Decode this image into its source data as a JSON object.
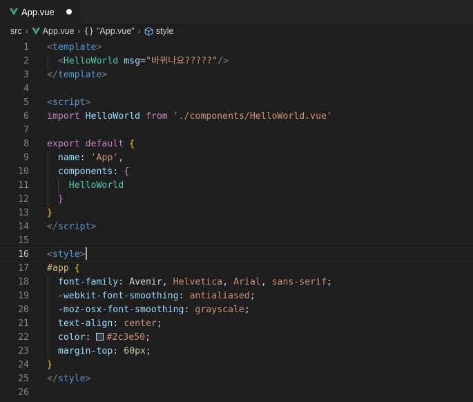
{
  "tab": {
    "label": "App.vue",
    "icon": "vue-logo-icon",
    "dirty": true
  },
  "breadcrumb": {
    "items": [
      "src",
      "App.vue",
      "\"App.vue\"",
      "style"
    ],
    "icons": [
      "",
      "vue-logo-icon",
      "braces-icon",
      "cube-icon"
    ],
    "braces_glyph": "{}"
  },
  "editor": {
    "current_line": 16,
    "lines": [
      {
        "n": "1",
        "tokens": [
          [
            "t-tag",
            "<"
          ],
          [
            "t-name",
            "template"
          ],
          [
            "t-tag",
            ">"
          ]
        ]
      },
      {
        "n": "2",
        "tokens": [
          [
            "t-plain",
            "  "
          ],
          [
            "t-tag",
            "<"
          ],
          [
            "t-comp",
            "HelloWorld"
          ],
          [
            "t-plain",
            " "
          ],
          [
            "t-attr",
            "msg"
          ],
          [
            "t-punc",
            "="
          ],
          [
            "t-str",
            "\"바뀌나요?????\""
          ],
          [
            "t-tag",
            "/>"
          ]
        ]
      },
      {
        "n": "3",
        "tokens": [
          [
            "t-tag",
            "</"
          ],
          [
            "t-name",
            "template"
          ],
          [
            "t-tag",
            ">"
          ]
        ]
      },
      {
        "n": "4",
        "tokens": []
      },
      {
        "n": "5",
        "tokens": [
          [
            "t-tag",
            "<"
          ],
          [
            "t-name",
            "script"
          ],
          [
            "t-tag",
            ">"
          ]
        ]
      },
      {
        "n": "6",
        "tokens": [
          [
            "t-kw",
            "import"
          ],
          [
            "t-plain",
            " "
          ],
          [
            "t-attr",
            "HelloWorld"
          ],
          [
            "t-plain",
            " "
          ],
          [
            "t-kw",
            "from"
          ],
          [
            "t-plain",
            " "
          ],
          [
            "t-str",
            "'./components/HelloWorld.vue'"
          ]
        ]
      },
      {
        "n": "7",
        "tokens": []
      },
      {
        "n": "8",
        "tokens": [
          [
            "t-kw",
            "export"
          ],
          [
            "t-plain",
            " "
          ],
          [
            "t-kw",
            "default"
          ],
          [
            "t-plain",
            " "
          ],
          [
            "t-brace1",
            "{"
          ]
        ]
      },
      {
        "n": "9",
        "tokens": [
          [
            "t-plain",
            "  "
          ],
          [
            "t-attr",
            "name"
          ],
          [
            "t-punc",
            ": "
          ],
          [
            "t-str",
            "'App'"
          ],
          [
            "t-punc",
            ","
          ]
        ]
      },
      {
        "n": "10",
        "tokens": [
          [
            "t-plain",
            "  "
          ],
          [
            "t-attr",
            "components"
          ],
          [
            "t-punc",
            ": "
          ],
          [
            "t-brace2",
            "{"
          ]
        ]
      },
      {
        "n": "11",
        "tokens": [
          [
            "t-plain",
            "    "
          ],
          [
            "t-comp",
            "HelloWorld"
          ]
        ]
      },
      {
        "n": "12",
        "tokens": [
          [
            "t-plain",
            "  "
          ],
          [
            "t-brace2",
            "}"
          ]
        ]
      },
      {
        "n": "13",
        "tokens": [
          [
            "t-brace1",
            "}"
          ]
        ]
      },
      {
        "n": "14",
        "tokens": [
          [
            "t-tag",
            "</"
          ],
          [
            "t-name",
            "script"
          ],
          [
            "t-tag",
            ">"
          ]
        ]
      },
      {
        "n": "15",
        "tokens": []
      },
      {
        "n": "16",
        "tokens": [
          [
            "t-tag",
            "<"
          ],
          [
            "t-name",
            "style"
          ],
          [
            "t-tag",
            ">"
          ]
        ],
        "cursor": true
      },
      {
        "n": "17",
        "tokens": [
          [
            "t-sel",
            "#app"
          ],
          [
            "t-plain",
            " "
          ],
          [
            "t-brace1",
            "{"
          ]
        ]
      },
      {
        "n": "18",
        "tokens": [
          [
            "t-plain",
            "  "
          ],
          [
            "t-prop",
            "font-family"
          ],
          [
            "t-punc",
            ": "
          ],
          [
            "t-plain",
            "Avenir"
          ],
          [
            "t-punc",
            ", "
          ],
          [
            "t-val",
            "Helvetica"
          ],
          [
            "t-punc",
            ", "
          ],
          [
            "t-val",
            "Arial"
          ],
          [
            "t-punc",
            ", "
          ],
          [
            "t-val",
            "sans-serif"
          ],
          [
            "t-punc",
            ";"
          ]
        ]
      },
      {
        "n": "19",
        "tokens": [
          [
            "t-plain",
            "  "
          ],
          [
            "t-prop",
            "-webkit-font-smoothing"
          ],
          [
            "t-punc",
            ": "
          ],
          [
            "t-val",
            "antialiased"
          ],
          [
            "t-punc",
            ";"
          ]
        ]
      },
      {
        "n": "20",
        "tokens": [
          [
            "t-plain",
            "  "
          ],
          [
            "t-prop",
            "-moz-osx-font-smoothing"
          ],
          [
            "t-punc",
            ": "
          ],
          [
            "t-val",
            "grayscale"
          ],
          [
            "t-punc",
            ";"
          ]
        ]
      },
      {
        "n": "21",
        "tokens": [
          [
            "t-plain",
            "  "
          ],
          [
            "t-prop",
            "text-align"
          ],
          [
            "t-punc",
            ": "
          ],
          [
            "t-val",
            "center"
          ],
          [
            "t-punc",
            ";"
          ]
        ]
      },
      {
        "n": "22",
        "tokens": [
          [
            "t-plain",
            "  "
          ],
          [
            "t-prop",
            "color"
          ],
          [
            "t-punc",
            ": "
          ],
          [
            "swatch",
            ""
          ],
          [
            "t-val",
            "#2c3e50"
          ],
          [
            "t-punc",
            ";"
          ]
        ]
      },
      {
        "n": "23",
        "tokens": [
          [
            "t-plain",
            "  "
          ],
          [
            "t-prop",
            "margin-top"
          ],
          [
            "t-punc",
            ": "
          ],
          [
            "t-num",
            "60px"
          ],
          [
            "t-punc",
            ";"
          ]
        ]
      },
      {
        "n": "24",
        "tokens": [
          [
            "t-brace1",
            "}"
          ]
        ]
      },
      {
        "n": "25",
        "tokens": [
          [
            "t-tag",
            "</"
          ],
          [
            "t-name",
            "style"
          ],
          [
            "t-tag",
            ">"
          ]
        ]
      },
      {
        "n": "26",
        "tokens": []
      }
    ]
  },
  "colors": {
    "background": "#1e1e1e",
    "tabbar": "#252526",
    "vue_green": "#41b883",
    "vue_dark": "#35495e",
    "swatch": "#2c3e50"
  }
}
